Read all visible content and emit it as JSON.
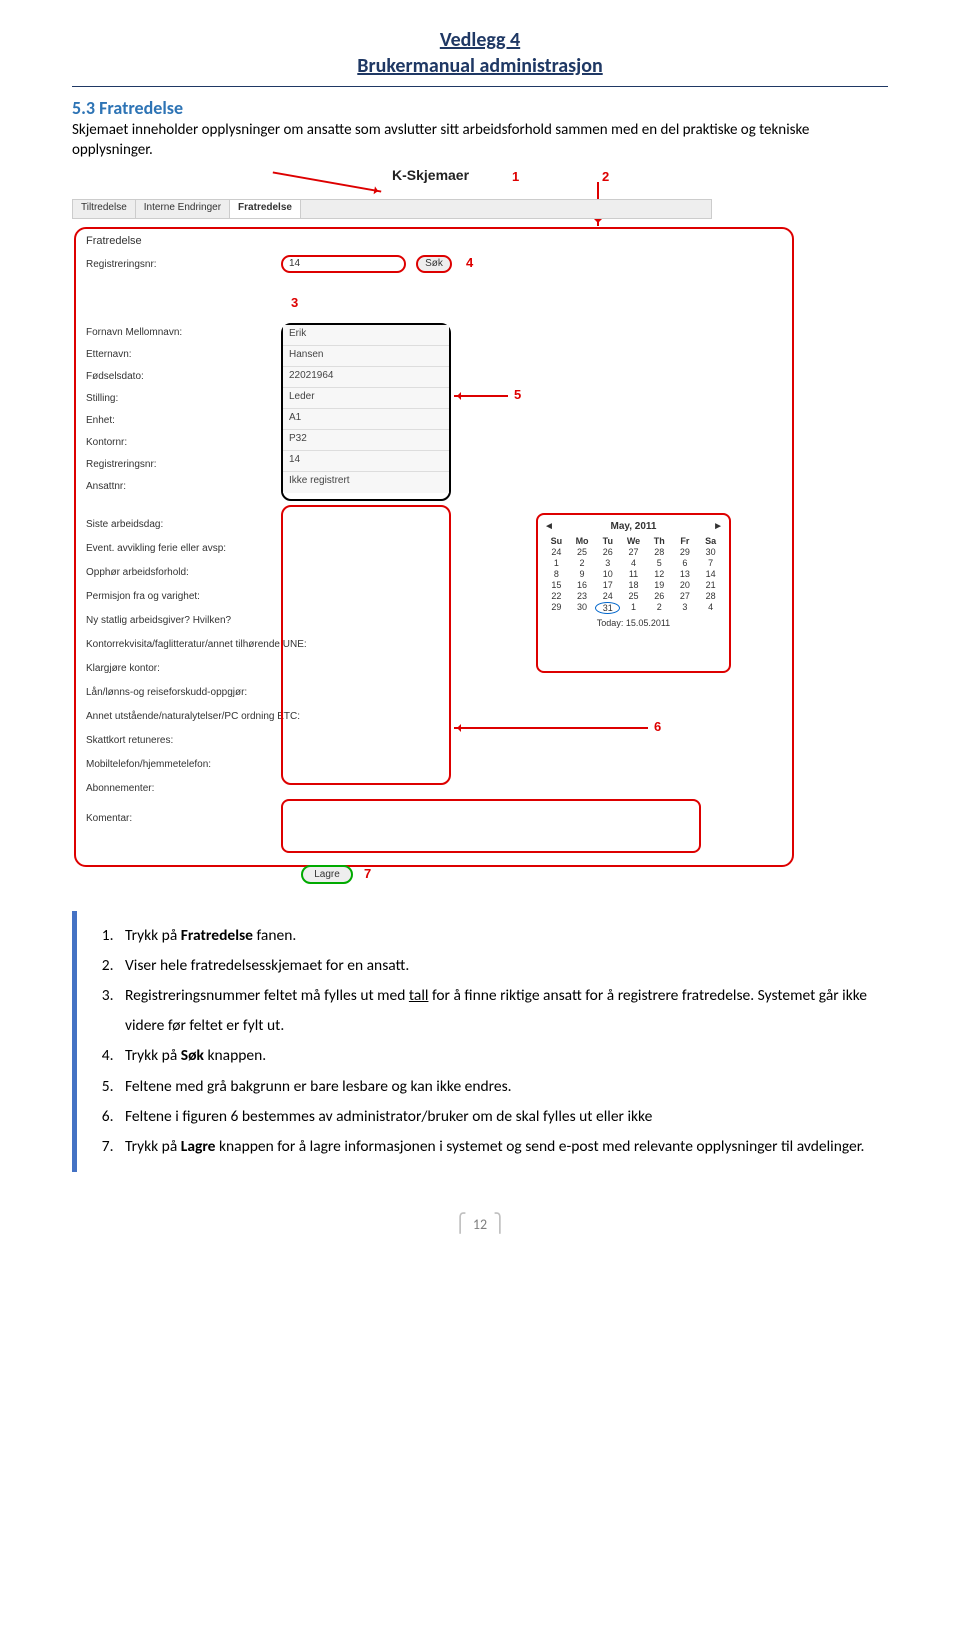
{
  "header": {
    "title1": "Vedlegg 4",
    "title2": "Brukermanual administrasjon"
  },
  "section": {
    "num": "5.3",
    "title": "Fratredelse",
    "intro": "Skjemaet inneholder opplysninger om ansatte som avslutter sitt arbeidsforhold sammen med en del praktiske og tekniske opplysninger."
  },
  "screenshot": {
    "app_title": "K-Skjemaer",
    "tabs": [
      "Tiltredelse",
      "Interne Endringer",
      "Fratredelse"
    ],
    "active_tab": 2,
    "form": {
      "title": "Fratredelse",
      "reg_label": "Registreringsnr:",
      "reg_value": "14",
      "sok": "Søk",
      "details_labels": [
        "Fornavn Mellomnavn:",
        "Etternavn:",
        "Fødselsdato:",
        "Stilling:",
        "Enhet:",
        "Kontornr:",
        "Registreringsnr:",
        "Ansattnr:"
      ],
      "details_values": [
        "Erik",
        "Hansen",
        "22021964",
        "Leder",
        "A1",
        "P32",
        "14",
        "Ikke registrert"
      ],
      "extra_labels": [
        "Siste arbeidsdag:",
        "Event. avvikling ferie eller avsp:",
        "Opphør arbeidsforhold:",
        "Permisjon fra og varighet:",
        "Ny statlig arbeidsgiver? Hvilken?",
        "Kontorrekvisita/faglitteratur/annet tilhørende UNE:",
        "Klargjøre kontor:",
        "Lån/lønns-og reiseforskudd-oppgjør:",
        "Annet utstående/naturalytelser/PC ordning ETC:",
        "Skattkort retuneres:",
        "Mobiltelefon/hjemmetelefon:",
        "Abonnementer:"
      ],
      "komentar_label": "Komentar:",
      "lagre": "Lagre"
    },
    "calendar": {
      "month": "May, 2011",
      "days": [
        "Su",
        "Mo",
        "Tu",
        "We",
        "Th",
        "Fr",
        "Sa"
      ],
      "weeks": [
        [
          "24",
          "25",
          "26",
          "27",
          "28",
          "29",
          "30"
        ],
        [
          "1",
          "2",
          "3",
          "4",
          "5",
          "6",
          "7"
        ],
        [
          "8",
          "9",
          "10",
          "11",
          "12",
          "13",
          "14"
        ],
        [
          "15",
          "16",
          "17",
          "18",
          "19",
          "20",
          "21"
        ],
        [
          "22",
          "23",
          "24",
          "25",
          "26",
          "27",
          "28"
        ],
        [
          "29",
          "30",
          "31",
          "1",
          "2",
          "3",
          "4"
        ]
      ],
      "today": "Today: 15.05.2011",
      "selected": "31"
    },
    "callouts": {
      "c1": "1",
      "c2": "2",
      "c3": "3",
      "c4": "4",
      "c5": "5",
      "c6": "6",
      "c7": "7"
    }
  },
  "steps": [
    "Trykk på <b>Fratredelse</b> fanen.",
    "Viser hele fratredelsesskjemaet for en ansatt.",
    "Registreringsnummer feltet må fylles ut med <u>tall</u> for å finne riktige ansatt for å registrere fratredelse. Systemet går ikke videre før feltet er fylt ut.",
    "Trykk på <b>Søk</b> knappen.",
    "Feltene med grå bakgrunn er bare lesbare og kan ikke endres.",
    "Feltene i figuren 6 bestemmes av administrator/bruker om de skal fylles ut eller ikke",
    "Trykk på <b>Lagre</b> knappen for å lagre informasjonen i systemet og send e-post med relevante opplysninger til avdelinger."
  ],
  "page_number": "12"
}
